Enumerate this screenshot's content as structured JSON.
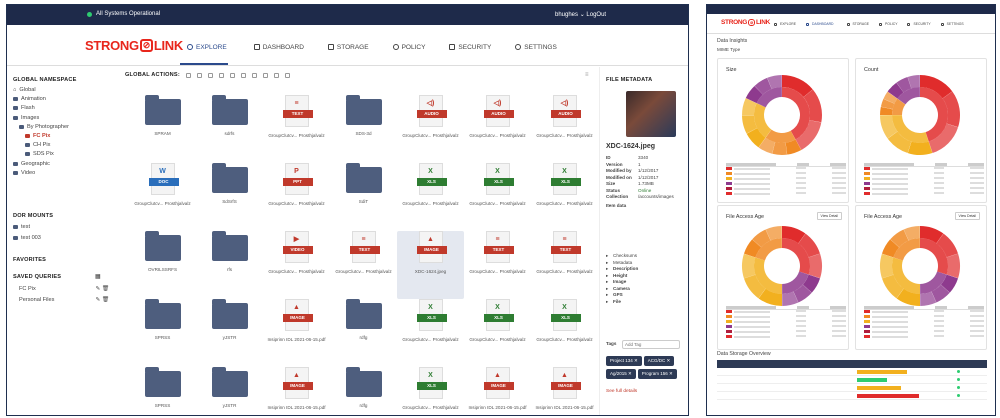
{
  "left_window": {
    "status": "All Systems Operational",
    "user": "bhughes",
    "logout": "LogOut",
    "nav": [
      "EXPLORE",
      "DASHBOARD",
      "STORAGE",
      "POLICY",
      "SECURITY",
      "SETTINGS"
    ],
    "logo": [
      "STRONG",
      "LINK"
    ],
    "sidebar": {
      "global_ns": "GLOBAL NAMESPACE",
      "ns_items": [
        "Global",
        "Animation",
        "Flash",
        "Images",
        "By Photographer",
        "FC Pix",
        "CH Pix",
        "SDS Pix",
        "Geographic",
        "Video"
      ],
      "dor_title": "DOR MOUNTS",
      "dor_items": [
        "test",
        "test 003"
      ],
      "favorites": "FAVORITES",
      "saved_title": "SAVED QUERIES",
      "saved_items": [
        "FC Pix",
        "Personal Files"
      ]
    },
    "main": {
      "global_actions": "GLOBAL ACTIONS:",
      "tiles": [
        {
          "kind": "folder",
          "label": "SPRAM"
        },
        {
          "kind": "folder",
          "label": "sdrfs"
        },
        {
          "kind": "doc",
          "type": "TEXT",
          "color": "#c0392b",
          "label": "GroupClutcv... Prosthjalvalz"
        },
        {
          "kind": "folder",
          "label": "SDS-3d"
        },
        {
          "kind": "doc",
          "type": "AUDIO",
          "color": "#c0392b",
          "label": "GroupClutcv... Prosthjalvalz"
        },
        {
          "kind": "doc",
          "type": "AUDIO",
          "color": "#c0392b",
          "label": "GroupClutcv... Prosthjalvalz"
        },
        {
          "kind": "doc",
          "type": "AUDIO",
          "color": "#c0392b",
          "label": "GroupClutcv... Prosthjalvalz"
        },
        {
          "kind": "doc",
          "type": "DOC",
          "color": "#2a6ebb",
          "label": "GroupClutcv... Prosthjalvalz"
        },
        {
          "kind": "folder",
          "label": "SdSrfS"
        },
        {
          "kind": "doc",
          "type": "PPT",
          "color": "#c0392b",
          "label": "GroupClutcv... Prosthjalvalz"
        },
        {
          "kind": "folder",
          "label": "SdiT"
        },
        {
          "kind": "doc",
          "type": "XLS",
          "color": "#2e7d32",
          "label": "GroupClutcv... Prosthjalvalz"
        },
        {
          "kind": "doc",
          "type": "XLS",
          "color": "#2e7d32",
          "label": "GroupClutcv... Prosthjalvalz"
        },
        {
          "kind": "doc",
          "type": "XLS",
          "color": "#2e7d32",
          "label": "GroupClutcv... Prosthjalvalz"
        },
        {
          "kind": "folder",
          "label": "OVRILSSRFS"
        },
        {
          "kind": "folder",
          "label": "rfs"
        },
        {
          "kind": "doc",
          "type": "VIDEO",
          "color": "#c0392b",
          "label": "GroupClutcv... Prosthjalvalz"
        },
        {
          "kind": "doc",
          "type": "TEXT",
          "color": "#c0392b",
          "label": "GroupClutcv... Prosthjalvalz"
        },
        {
          "kind": "doc",
          "type": "IMAGE",
          "color": "#c0392b",
          "label": "XDC-1624.jpeg",
          "selected": true
        },
        {
          "kind": "doc",
          "type": "TEXT",
          "color": "#c0392b",
          "label": "GroupClutcv... Prosthjalvalz"
        },
        {
          "kind": "doc",
          "type": "TEXT",
          "color": "#c0392b",
          "label": "GroupClutcv... Prosthjalvalz"
        },
        {
          "kind": "folder",
          "label": "SPRSS"
        },
        {
          "kind": "folder",
          "label": "yJSTR"
        },
        {
          "kind": "doc",
          "type": "IMAGE",
          "color": "#c0392b",
          "label": "Insiprinn IDL 2021-06-15.pdf"
        },
        {
          "kind": "folder",
          "label": "rdfg"
        },
        {
          "kind": "doc",
          "type": "XLS",
          "color": "#2e7d32",
          "label": "GroupClutcv... Prosthjalvalz"
        },
        {
          "kind": "doc",
          "type": "XLS",
          "color": "#2e7d32",
          "label": "GroupClutcv... Prosthjalvalz"
        },
        {
          "kind": "doc",
          "type": "XLS",
          "color": "#2e7d32",
          "label": "GroupClutcv... Prosthjalvalz"
        },
        {
          "kind": "folder",
          "label": "SPRSS"
        },
        {
          "kind": "folder",
          "label": "yJSTR"
        },
        {
          "kind": "doc",
          "type": "IMAGE",
          "color": "#c0392b",
          "label": "Insiprinn IDL 2021-06-15.pdf"
        },
        {
          "kind": "folder",
          "label": "rdfg"
        },
        {
          "kind": "doc",
          "type": "XLS",
          "color": "#2e7d32",
          "label": "GroupClutcv... Prosthjalvalz"
        },
        {
          "kind": "doc",
          "type": "IMAGE",
          "color": "#c0392b",
          "label": "Insiprinn IDL 2021-06-15.pdf"
        },
        {
          "kind": "doc",
          "type": "IMAGE",
          "color": "#c0392b",
          "label": "Insiprinn IDL 2021-06-15.pdf"
        }
      ]
    },
    "metadata": {
      "title": "FILE METADATA",
      "filename": "XDC-1624.jpeg",
      "rows": [
        [
          "ID",
          "3340"
        ],
        [
          "Version",
          "1"
        ],
        [
          "Modified by",
          "1/12/2017"
        ],
        [
          "Modified on",
          "1/12/2017"
        ],
        [
          "Size",
          "1.73MB"
        ],
        [
          "Status",
          "Online"
        ],
        [
          "Collection",
          "/accounts/images"
        ]
      ],
      "item_data": "Item data",
      "checkboxes": [
        "Checksums",
        "Metadata",
        "Description",
        "Height",
        "Image",
        "Camera",
        "GPS",
        "File"
      ],
      "tags_label": "Tags",
      "tags_placeholder": "Add Tag",
      "tags": [
        "Project 134",
        "ACG/DC",
        "Ag/2015",
        "Program 156"
      ],
      "link": "See full details"
    }
  },
  "right_window": {
    "nav": [
      "EXPLORE",
      "DASHBOARD",
      "STORAGE",
      "POLICY",
      "SECURITY",
      "SETTINGS"
    ],
    "logo": [
      "STRONG",
      "LINK"
    ],
    "section": "Data Insights",
    "subsection": "MIME Type",
    "cards": [
      {
        "title": "Size",
        "button": ""
      },
      {
        "title": "Count",
        "button": ""
      },
      {
        "title": "File Access Age",
        "button": "View Detail"
      },
      {
        "title": "File Access Age",
        "button": "View Detail"
      }
    ],
    "storage_title": "Data Storage Overview",
    "colors": {
      "red": "#e02c2c",
      "orange": "#f08a24",
      "yellow": "#f2b01e",
      "purple": "#8e3a8e",
      "darkred": "#b01e3c"
    }
  }
}
